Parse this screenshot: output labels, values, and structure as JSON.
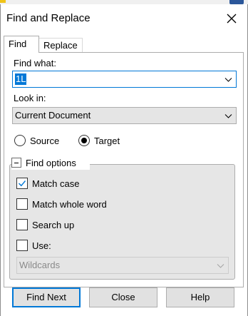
{
  "dialog": {
    "title": "Find and Replace",
    "tabs": [
      {
        "label": "Find",
        "active": true
      },
      {
        "label": "Replace",
        "active": false
      }
    ]
  },
  "find": {
    "find_what_label": "Find what:",
    "find_what_value": "1L",
    "look_in_label": "Look in:",
    "look_in_value": "Current Document",
    "radios": [
      {
        "label": "Source",
        "checked": false
      },
      {
        "label": "Target",
        "checked": true
      }
    ],
    "options": {
      "legend": "Find options",
      "items": [
        {
          "label": "Match case",
          "checked": true
        },
        {
          "label": "Match whole word",
          "checked": false
        },
        {
          "label": "Search up",
          "checked": false
        },
        {
          "label": "Use:",
          "checked": false
        }
      ],
      "use_value": "Wildcards"
    }
  },
  "buttons": {
    "find_next": "Find Next",
    "close": "Close",
    "help": "Help"
  },
  "colors": {
    "accent": "#0078d7",
    "group_bg": "#e6e6e6"
  }
}
